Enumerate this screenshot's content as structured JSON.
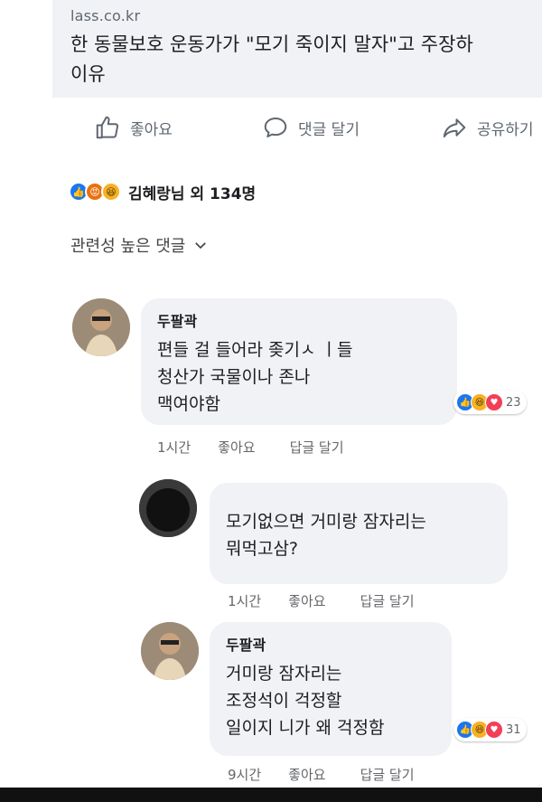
{
  "link": {
    "domain": "lass.co.kr",
    "title": "한 동물보호 운동가가 \"모기 죽이지 말자\"고 주장하\n이유"
  },
  "actions": {
    "like": "좋아요",
    "comment": "댓글 달기",
    "share": "공유하기"
  },
  "reactions": {
    "summary": "김혜랑님 외 134명"
  },
  "sort": {
    "label": "관련성 높은 댓글"
  },
  "comments": [
    {
      "author": "두팔곽",
      "text": "편들 걸 들어라 좆기ㅅ     ㅣ들\n청산가     국물이나 존나\n맥여야함",
      "reaction_count": "23",
      "time": "1시간",
      "like": "좋아요",
      "reply": "답글 달기"
    },
    {
      "author": "",
      "text": "모기없으면 거미랑 잠자리는\n뭐먹고삼?",
      "time": "1시간",
      "like": "좋아요",
      "reply": "답글 달기"
    },
    {
      "author": "두팔곽",
      "text": "거미랑 잠자리는\n조정석이 걱정할\n일이지 니가 왜 걱정함",
      "reaction_count": "31",
      "time": "9시간",
      "like": "좋아요",
      "reply": "답글 달기"
    }
  ],
  "colors": {
    "like_blue": "#1877f2",
    "bubble_bg": "#f0f2f5",
    "meta_gray": "#65676b"
  }
}
